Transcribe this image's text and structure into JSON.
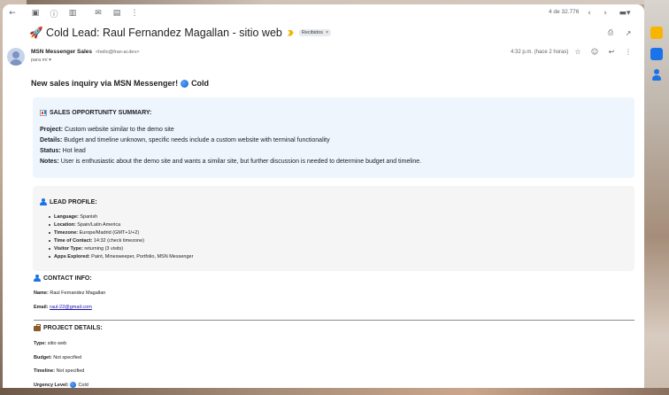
{
  "toolbar": {
    "pager_text": "4 de 32.776",
    "icons": [
      "back-icon",
      "archive-icon",
      "report-spam-icon",
      "delete-icon",
      "mark-unread-icon",
      "move-icon",
      "more-icon",
      "prev-icon",
      "next-icon",
      "keyboard-icon"
    ]
  },
  "email": {
    "subject": "🚀 Cold Lead: Raul Fernandez Magallan - sitio web",
    "label_chip": "Recibidos",
    "label_chip_close": "×",
    "sender_name": "MSN Messenger Sales",
    "sender_email": "<hello@fran-ai.dev>",
    "to": "para mí ▾",
    "time": "4:32 p.m. (hace 2 horas)"
  },
  "body": {
    "headline_text": "New sales inquiry via MSN Messenger!",
    "headline_status": "Cold",
    "summary": {
      "title": "SALES OPPORTUNITY SUMMARY:",
      "project_label": "Project:",
      "project_value": " Custom website similar to the demo site",
      "details_label": "Details:",
      "details_value": " Budget and timeline unknown, specific needs include a custom website with terminal functionality",
      "status_label": "Status:",
      "status_value": " Hot lead",
      "notes_label": "Notes:",
      "notes_value": " User is enthusiastic about the demo site and wants a similar site, but further discussion is needed to determine budget and timeline."
    },
    "profile": {
      "title": "LEAD PROFILE:",
      "items": [
        {
          "label": "Language:",
          "value": " Spanish"
        },
        {
          "label": "Location:",
          "value": " Spain/Latin America"
        },
        {
          "label": "Timezone:",
          "value": " Europe/Madrid (GMT+1/+2)"
        },
        {
          "label": "Time of Contact:",
          "value": " 14:32 (check timezone)"
        },
        {
          "label": "Visitor Type:",
          "value": " returning (3 visits)"
        },
        {
          "label": "Apps Explored:",
          "value": " Paint, Minesweeper, Portfolio, MSN Messenger"
        }
      ]
    },
    "contact": {
      "title": "CONTACT INFO:",
      "name_label": "Name:",
      "name_value": " Raul Fernandez Magallan",
      "email_label": "Email:",
      "email_value": "raul-22@gmail.com"
    },
    "project": {
      "title": "PROJECT DETAILS:",
      "type_label": "Type:",
      "type_value": " sitio web",
      "budget_label": "Budget:",
      "budget_value": " Not specified",
      "timeline_label": "Timeline:",
      "timeline_value": " Not specified",
      "urgency_label": "Urgency Level:",
      "urgency_value": "Cold"
    }
  }
}
